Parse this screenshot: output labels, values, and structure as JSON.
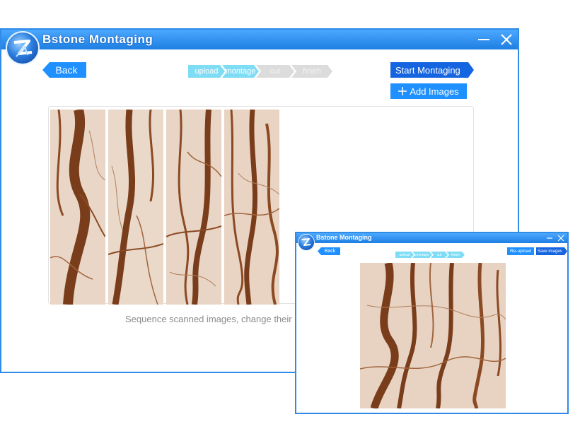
{
  "main_window": {
    "title": "Bstone Montaging",
    "back_label": "Back",
    "steps": [
      {
        "label": "upload",
        "state": "active"
      },
      {
        "label": "montage",
        "state": "active"
      },
      {
        "label": "cut",
        "state": "todo"
      },
      {
        "label": "finish",
        "state": "todo"
      }
    ],
    "start_label": "Start Montaging",
    "add_images_label": "Add Images",
    "hint_text": "Sequence scanned images, change their ("
  },
  "popup_window": {
    "title": "Bstone Montaging",
    "back_label": "Back",
    "steps": [
      {
        "label": "upload",
        "state": "active"
      },
      {
        "label": "montage",
        "state": "active"
      },
      {
        "label": "cut",
        "state": "active"
      },
      {
        "label": "finish",
        "state": "active"
      }
    ],
    "reupload_label": "Re-upload",
    "save_label": "Save images"
  },
  "colors": {
    "title_bar": "#1e7fe3",
    "primary_button": "#1e90ff",
    "dark_button": "#1565e0",
    "step_active": "#7fdcf5",
    "step_todo": "#dcdcdc",
    "marble_base": "#e8d3c3",
    "marble_vein": "#7a3d1c"
  }
}
